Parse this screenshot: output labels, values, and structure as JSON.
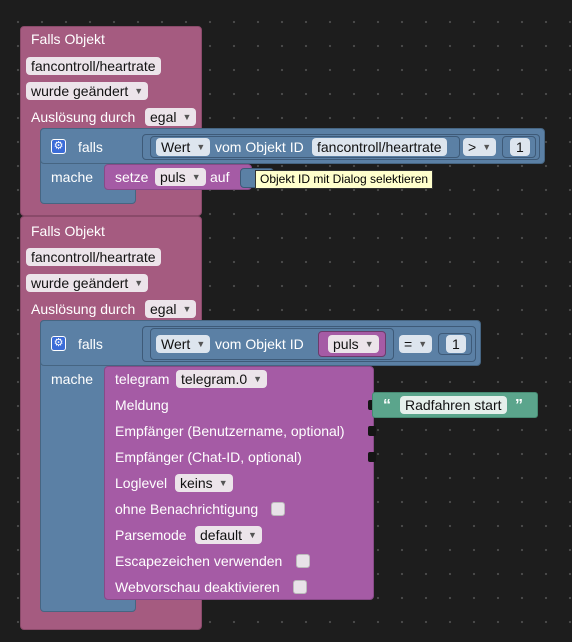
{
  "blocks": {
    "block1": {
      "title": "Falls Objekt",
      "object_id": "fancontroll/heartrate",
      "trigger": "wurde geändert",
      "trigger_by_label": "Auslösung durch",
      "trigger_by_value": "egal",
      "if_label": "falls",
      "do_label": "mache",
      "value_select": "Wert",
      "of_object_label": "vom Objekt ID",
      "compare_object": "fancontroll/heartrate",
      "operator": ">",
      "number": "1",
      "set_label": "setze",
      "variable": "puls",
      "to_label": "auf",
      "tooltip": "Objekt ID mit Dialog selektieren"
    },
    "block2": {
      "title": "Falls Objekt",
      "object_id": "fancontroll/heartrate",
      "trigger": "wurde geändert",
      "trigger_by_label": "Auslösung durch",
      "trigger_by_value": "egal",
      "if_label": "falls",
      "do_label": "mache",
      "value_select": "Wert",
      "of_object_label": "vom Objekt ID",
      "variable": "puls",
      "operator": "=",
      "number": "1",
      "telegram": {
        "label": "telegram",
        "instance": "telegram.0",
        "message_label": "Meldung",
        "message_text": "Radfahren start",
        "recipient_user_label": "Empfänger (Benutzername, optional)",
        "recipient_chat_label": "Empfänger (Chat-ID, optional)",
        "loglevel_label": "Loglevel",
        "loglevel_value": "keins",
        "silent_label": "ohne Benachrichtigung",
        "parsemode_label": "Parsemode",
        "parsemode_value": "default",
        "escape_label": "Escapezeichen verwenden",
        "webpreview_label": "Webvorschau deaktivieren"
      }
    }
  },
  "colors": {
    "event": "#a55b80",
    "control": "#5b80a5",
    "action": "#a55ba5",
    "text": "#5ba58c",
    "tooltip": "#ffffcc"
  },
  "icons": [
    "gear-icon",
    "dropdown-caret-icon",
    "quote-open-icon",
    "quote-close-icon"
  ]
}
